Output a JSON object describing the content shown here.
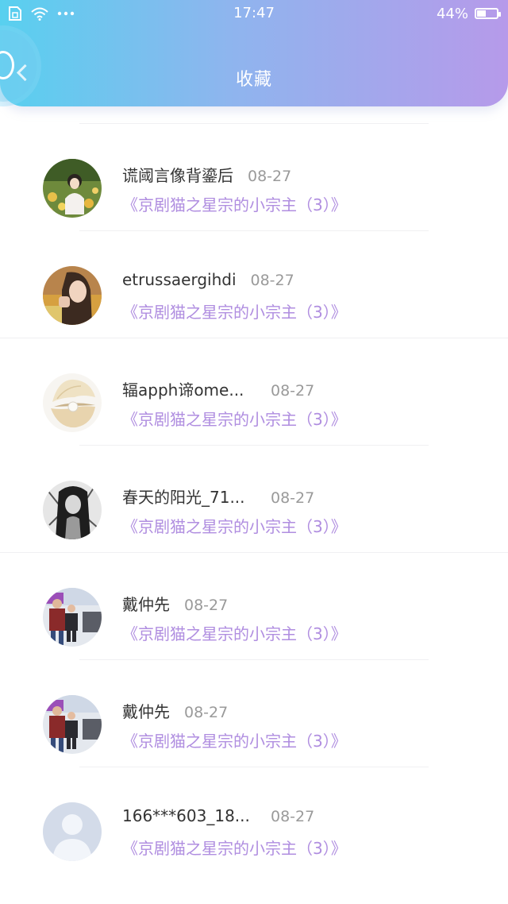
{
  "status_bar": {
    "time": "17:47",
    "battery": "44%",
    "battery_level": 0.44
  },
  "header": {
    "title": "收藏",
    "back_icon": "back-circle-icon"
  },
  "items": [
    {
      "name": "谎阈言像背鎏后",
      "date": "08-27",
      "title": "《京剧猫之星宗的小宗主（3）》",
      "avatar": "avatar-girl-flowers"
    },
    {
      "name": "etrussaergihdi",
      "date": "08-27",
      "title": "《京剧猫之星宗的小宗主（3）》",
      "avatar": "avatar-woman-selfie"
    },
    {
      "name": "辐apph谛ome...",
      "date": "08-27",
      "title": "《京剧猫之星宗的小宗主（3）》",
      "avatar": "avatar-pearl-shell"
    },
    {
      "name": "春天的阳光_71...",
      "date": "08-27",
      "title": "《京剧猫之星宗的小宗主（3）》",
      "avatar": "avatar-anime-sketch"
    },
    {
      "name": "戴仲先",
      "date": "08-27",
      "title": "《京剧猫之星宗的小宗主（3）》",
      "avatar": "avatar-family-photo"
    },
    {
      "name": "戴仲先",
      "date": "08-27",
      "title": "《京剧猫之星宗的小宗主（3）》",
      "avatar": "avatar-family-photo"
    },
    {
      "name": "166***603_18...",
      "date": "08-27",
      "title": "《京剧猫之星宗的小宗主（3）》",
      "avatar": "avatar-default-person"
    }
  ],
  "colors": {
    "header_gradient_start": "#58d0ef",
    "header_gradient_end": "#b69aea",
    "title_purple": "#b08ee0",
    "date_gray": "#9a9a9a"
  }
}
